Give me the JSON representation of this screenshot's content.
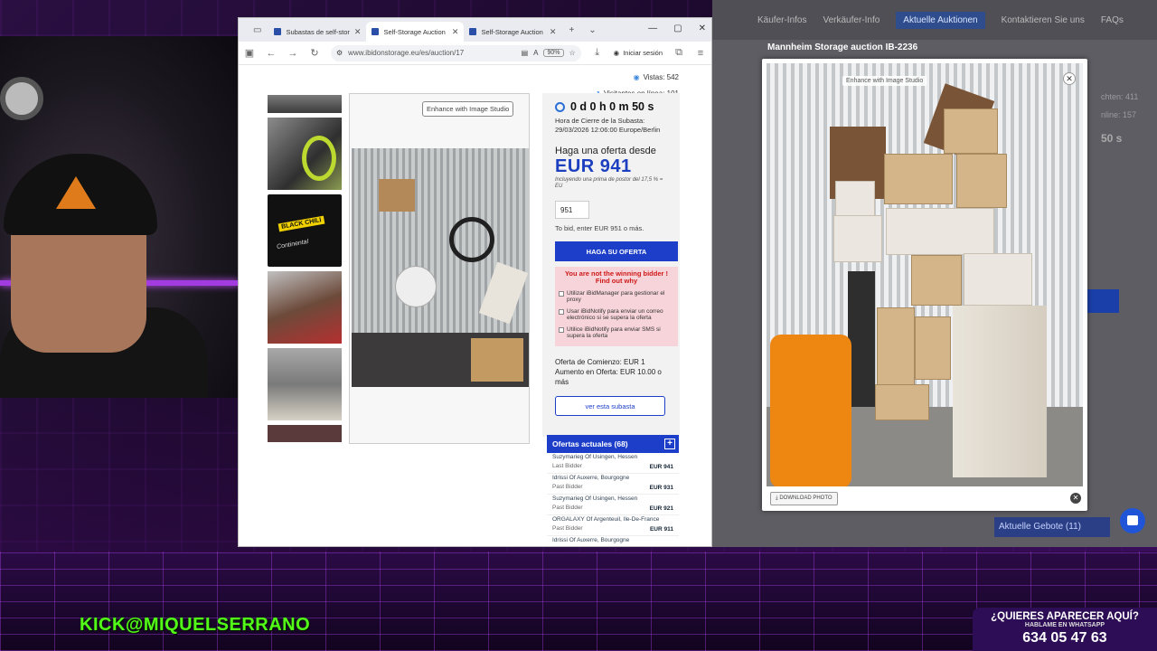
{
  "stream": {
    "kick_label": "KICK",
    "handle": "@MIQUELSERRANO",
    "promo_line1": "¿QUIERES APARECER AQUÍ?",
    "promo_line2": "HABLAME EN WHATSAPP",
    "promo_phone": "634 05 47 63"
  },
  "browser": {
    "tabs": [
      {
        "label": "Subastas de self-storag",
        "active": false
      },
      {
        "label": "Self-Storage Auction IB",
        "active": true
      },
      {
        "label": "Self-Storage Auction IB",
        "active": false
      }
    ],
    "url": "www.ibidonstorage.eu/es/auction/17",
    "zoom": "90%",
    "signin_label": "Iniciar sesión"
  },
  "page": {
    "views": "Vistas: 542",
    "online": "Visitantes en línea: 101",
    "enhance_label": "Enhance with Image Studio",
    "timer": "0 d 0 h 0 m 50 s",
    "close_label": "Hora de Cierre de la Subasta:",
    "close_time": "29/03/2026 12:06:00 Europe/Berlin",
    "offer_from": "Haga una oferta desde",
    "price": "EUR 941",
    "premium_note": "Incluyendo una prima de postor del 17,5 % = EU",
    "bid_value": "951",
    "bid_hint": "To bid, enter EUR 951 o más.",
    "bid_button": "HAGA SU OFERTA",
    "not_winning": "You are not the winning bidder ! Find out why",
    "options": [
      "Utilizar iBidManager para gestionar el proxy",
      "Usar iBidNotify para enviar un correo electrónico si se supera la oferta",
      "Utilice iBidNotify para enviar SMS si supera la oferta"
    ],
    "start_offer": "Oferta de Comienzo: EUR 1",
    "increment": "Aumento en Oferta: EUR 10.00 o más",
    "see_button": "ver esta subasta",
    "offers_title": "Ofertas actuales (68)",
    "offers": [
      {
        "name": "Suzymarieg Of Usingen, Hessen",
        "type": "Last Bidder",
        "amount": "EUR 941"
      },
      {
        "name": "Idrissi Of Auxerre, Bourgogne",
        "type": "Past Bidder",
        "amount": "EUR 931"
      },
      {
        "name": "Suzymarieg Of Usingen, Hessen",
        "type": "Past Bidder",
        "amount": "EUR 921"
      },
      {
        "name": "ORGALAXY Of Argenteuil, Ile-De-France",
        "type": "Past Bidder",
        "amount": "EUR 911"
      },
      {
        "name": "Idrissi Of Auxerre, Bourgogne",
        "type": "",
        "amount": ""
      }
    ],
    "thumb_labels": [
      "BLACK CHILI",
      "Continental"
    ]
  },
  "lightbox": {
    "title": "Mannheim Storage auction IB-2236",
    "enhance_label": "Enhance with Image Studio",
    "download_label": "DOWNLOAD PHOTO"
  },
  "background_browser": {
    "nav": [
      "Käufer-Infos",
      "Verkäufer-Info",
      "Aktuelle Auktionen",
      "Kontaktieren Sie uns",
      "FAQs"
    ],
    "stats": [
      "chten: 411",
      "nline: 157"
    ],
    "timer_partial": "50 s",
    "offers_title": "Aktuelle Gebote (11)"
  }
}
